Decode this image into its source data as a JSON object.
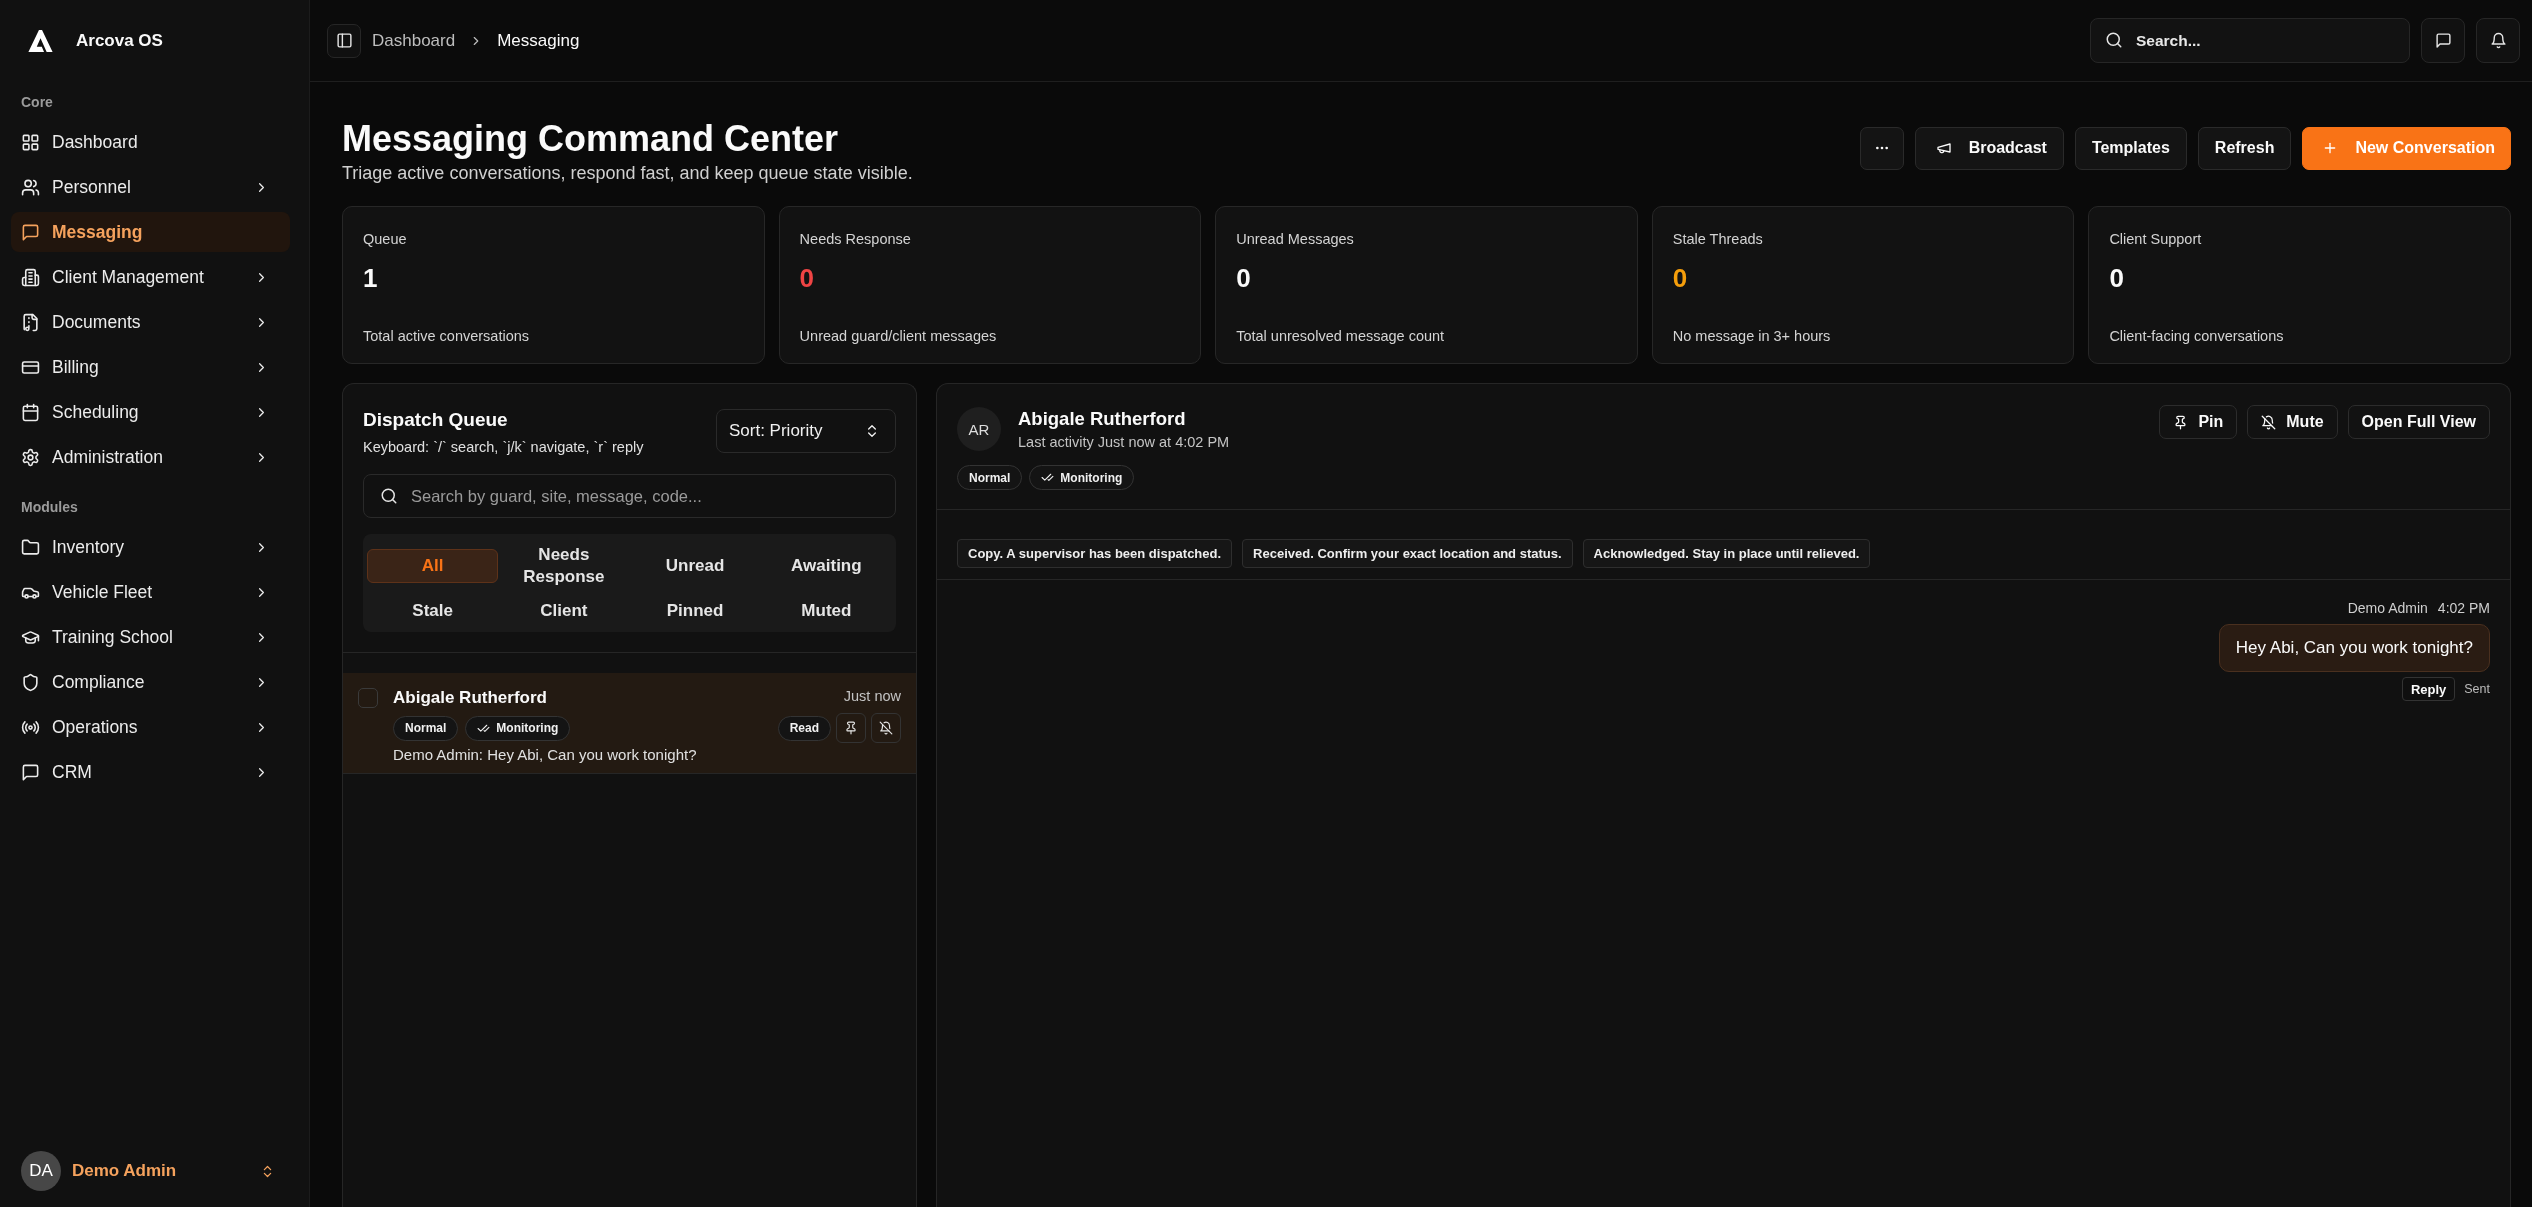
{
  "sidebar": {
    "brand": "Arcova OS",
    "sections": [
      {
        "label": "Core",
        "items": [
          {
            "label": "Dashboard",
            "selected": false,
            "expandable": false
          },
          {
            "label": "Personnel",
            "selected": false,
            "expandable": true
          },
          {
            "label": "Messaging",
            "selected": true,
            "expandable": false
          },
          {
            "label": "Client Management",
            "selected": false,
            "expandable": true
          },
          {
            "label": "Documents",
            "selected": false,
            "expandable": true
          },
          {
            "label": "Billing",
            "selected": false,
            "expandable": true
          },
          {
            "label": "Scheduling",
            "selected": false,
            "expandable": true
          },
          {
            "label": "Administration",
            "selected": false,
            "expandable": true
          }
        ]
      },
      {
        "label": "Modules",
        "items": [
          {
            "label": "Inventory",
            "selected": false,
            "expandable": true
          },
          {
            "label": "Vehicle Fleet",
            "selected": false,
            "expandable": true
          },
          {
            "label": "Training School",
            "selected": false,
            "expandable": true
          },
          {
            "label": "Compliance",
            "selected": false,
            "expandable": true
          },
          {
            "label": "Operations",
            "selected": false,
            "expandable": true
          },
          {
            "label": "CRM",
            "selected": false,
            "expandable": true
          }
        ]
      }
    ],
    "user": {
      "initials": "DA",
      "name": "Demo Admin"
    }
  },
  "topbar": {
    "breadcrumb": [
      {
        "label": "Dashboard",
        "current": false
      },
      {
        "label": "Messaging",
        "current": true
      }
    ],
    "search": {
      "placeholder": "Search..."
    }
  },
  "page": {
    "title": "Messaging Command Center",
    "subtitle": "Triage active conversations, respond fast, and keep queue state visible.",
    "actions": [
      {
        "kind": "overflow"
      },
      {
        "kind": "broadcast",
        "label": "Broadcast"
      },
      {
        "kind": "plain",
        "label": "Templates"
      },
      {
        "kind": "plain",
        "label": "Refresh"
      },
      {
        "kind": "primary",
        "label": "New Conversation"
      }
    ]
  },
  "stats": [
    {
      "label": "Queue",
      "value": "1",
      "note": "Total active conversations",
      "color": "#fafafa"
    },
    {
      "label": "Needs Response",
      "value": "0",
      "note": "Unread guard/client messages",
      "color": "#ef4444"
    },
    {
      "label": "Unread Messages",
      "value": "0",
      "note": "Total unresolved message count",
      "color": "#fafafa"
    },
    {
      "label": "Stale Threads",
      "value": "0",
      "note": "No message in 3+ hours",
      "color": "#f59e0b"
    },
    {
      "label": "Client Support",
      "value": "0",
      "note": "Client-facing conversations",
      "color": "#fafafa"
    }
  ],
  "queue": {
    "title": "Dispatch Queue",
    "hint": "Keyboard: `/` search, `j/k` navigate, `r` reply",
    "sort": "Sort: Priority",
    "search": {
      "placeholder": "Search by guard, site, message, code..."
    },
    "filters": [
      {
        "label": "All",
        "selected": true
      },
      {
        "label": "Needs Response",
        "selected": false
      },
      {
        "label": "Unread",
        "selected": false
      },
      {
        "label": "Awaiting",
        "selected": false
      },
      {
        "label": "Stale",
        "selected": false
      },
      {
        "label": "Client",
        "selected": false
      },
      {
        "label": "Pinned",
        "selected": false
      },
      {
        "label": "Muted",
        "selected": false
      }
    ],
    "conversations": [
      {
        "name": "Abigale Rutherford",
        "time": "Just now",
        "selected": true,
        "checked": false,
        "tags": [
          {
            "label": "Normal",
            "kind": "plain"
          },
          {
            "label": "Monitoring",
            "kind": "status"
          }
        ],
        "preview": "Demo Admin: Hey Abi, Can you work tonight?",
        "status": "Read"
      }
    ]
  },
  "conversation": {
    "contact": {
      "initials": "AR",
      "name": "Abigale Rutherford",
      "last_activity": "Last activity Just now at 4:02 PM",
      "tags": [
        {
          "label": "Normal",
          "kind": "plain"
        },
        {
          "label": "Monitoring",
          "kind": "status"
        }
      ]
    },
    "actions": [
      {
        "label": "Pin",
        "kind": "pin"
      },
      {
        "label": "Mute",
        "kind": "mute"
      },
      {
        "label": "Open Full View",
        "kind": "plain"
      }
    ],
    "quick_replies": [
      "Copy. A supervisor has been dispatched.",
      "Received. Confirm your exact location and status.",
      "Acknowledged. Stay in place until relieved."
    ],
    "messages": [
      {
        "author": "Demo Admin",
        "time": "4:02 PM",
        "text": "Hey Abi, Can you work tonight?",
        "outgoing": true,
        "reply_label": "Reply",
        "status": "Sent"
      }
    ]
  }
}
